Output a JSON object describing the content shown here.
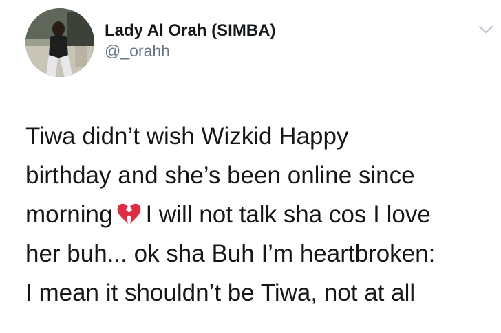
{
  "author": {
    "display_name": "Lady Al Orah (SIMBA)",
    "handle": "@_orahh",
    "avatar_icon": "profile-photo"
  },
  "menu": {
    "chevron_icon": "chevron-down-icon"
  },
  "tweet": {
    "line1": "Tiwa didn’t wish Wizkid Happy",
    "line2": "birthday and she’s been online since",
    "line3_before": "morning",
    "line3_emoji": "broken-heart-icon",
    "line3_after": "I will not talk sha cos I love",
    "line4": "her buh... ok sha Buh I’m heartbroken:",
    "line5": "I mean it shouldn’t be Tiwa, not at all"
  },
  "colors": {
    "text": "#14171a",
    "secondary": "#657786",
    "broken_heart": "#dd2e44"
  }
}
